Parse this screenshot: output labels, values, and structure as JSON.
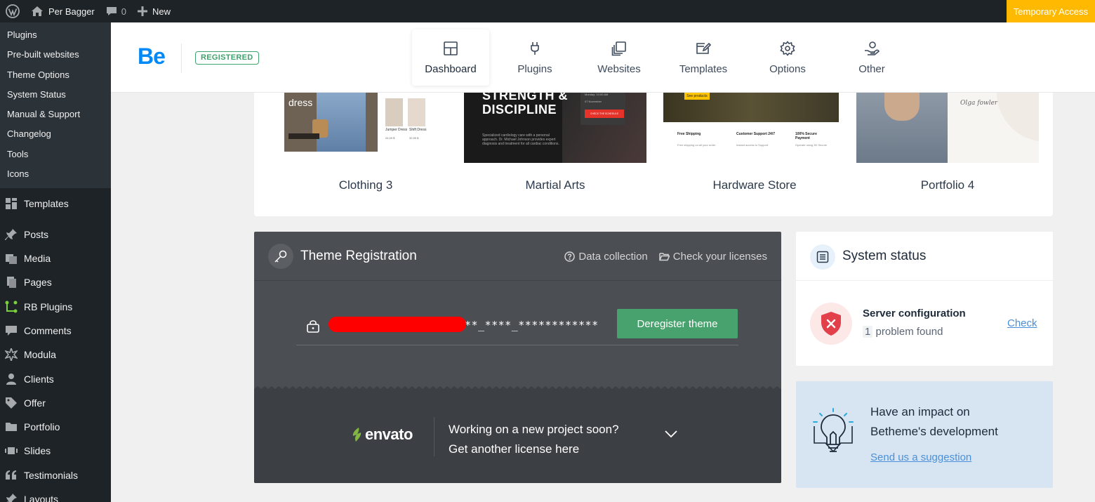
{
  "adminbar": {
    "site_name": "Per Bagger",
    "comments_count": "0",
    "new_label": "New",
    "temporary_access": "Temporary Access"
  },
  "sidebar": {
    "submenu": [
      "Plugins",
      "Pre-built websites",
      "Theme Options",
      "System Status",
      "Manual & Support",
      "Changelog",
      "Tools",
      "Icons"
    ],
    "menu": [
      {
        "label": "Templates",
        "icon": "templates-icon"
      },
      {
        "label": "Posts",
        "icon": "pin-icon"
      },
      {
        "label": "Media",
        "icon": "media-icon"
      },
      {
        "label": "Pages",
        "icon": "pages-icon"
      },
      {
        "label": "RB Plugins",
        "icon": "rb-plugins-icon"
      },
      {
        "label": "Comments",
        "icon": "comment-icon"
      },
      {
        "label": "Modula",
        "icon": "modula-icon"
      },
      {
        "label": "Clients",
        "icon": "user-icon"
      },
      {
        "label": "Offer",
        "icon": "tag-icon"
      },
      {
        "label": "Portfolio",
        "icon": "folder-icon"
      },
      {
        "label": "Slides",
        "icon": "slides-icon"
      },
      {
        "label": "Testimonials",
        "icon": "quote-icon"
      },
      {
        "label": "Layouts",
        "icon": "pin-icon"
      }
    ]
  },
  "header": {
    "logo": "Be",
    "badge": "REGISTERED",
    "tabs": [
      {
        "label": "Dashboard",
        "active": true
      },
      {
        "label": "Plugins"
      },
      {
        "label": "Websites"
      },
      {
        "label": "Templates"
      },
      {
        "label": "Options"
      },
      {
        "label": "Other"
      }
    ]
  },
  "websites": {
    "items": [
      {
        "name": "Clothing 3",
        "thumb_text": "dress",
        "product_1": "Jumper Dress",
        "product_2": "Shift Dress",
        "price_1": "24,00 $",
        "price_2": "32,90 $"
      },
      {
        "name": "Martial Arts",
        "thumb_text_1": "STRENGTH &",
        "thumb_text_2": "DISCIPLINE",
        "caption": "Specialized cardiology care with a personal approach. Dr. Michael Johnson provides expert diagnosis and treatment for all cardiac conditions.",
        "button": "CHECK THE SCHEDULE",
        "info_1": "Monday: 10:00 AM",
        "info_2": "07 November"
      },
      {
        "name": "Hardware Store",
        "badge": "See products",
        "feature_1_title": "Free Shipping",
        "feature_1_sub": "Free shipping on all your order",
        "feature_2_title": "Customer Support 24/7",
        "feature_2_sub": "Instant access to Support",
        "feature_3_title": "100% Secure Payment",
        "feature_3_sub": "Operate using 3D Secure"
      },
      {
        "name": "Portfolio 4",
        "signature": "Olga fowler"
      }
    ]
  },
  "registration": {
    "title": "Theme Registration",
    "data_collection": "Data collection",
    "check_licenses": "Check your licenses",
    "license_mask": "**_****_************",
    "deregister": "Deregister theme",
    "envato": "envato",
    "promo_line_1": "Working on a new project soon?",
    "promo_line_2": "Get another license here"
  },
  "system_status": {
    "title": "System status",
    "server_title": "Server configuration",
    "problem_count": "1",
    "problem_text": "problem found",
    "check": "Check"
  },
  "suggestion": {
    "line_1": "Have an impact on",
    "line_2": "Betheme's development",
    "link": "Send us a suggestion"
  },
  "colors": {
    "accent_blue": "#0089f7",
    "registered_green": "#3ea36d",
    "deregister_green": "#48a26d",
    "temp_access_yellow": "#ffb900",
    "error_red": "#e2404b"
  }
}
